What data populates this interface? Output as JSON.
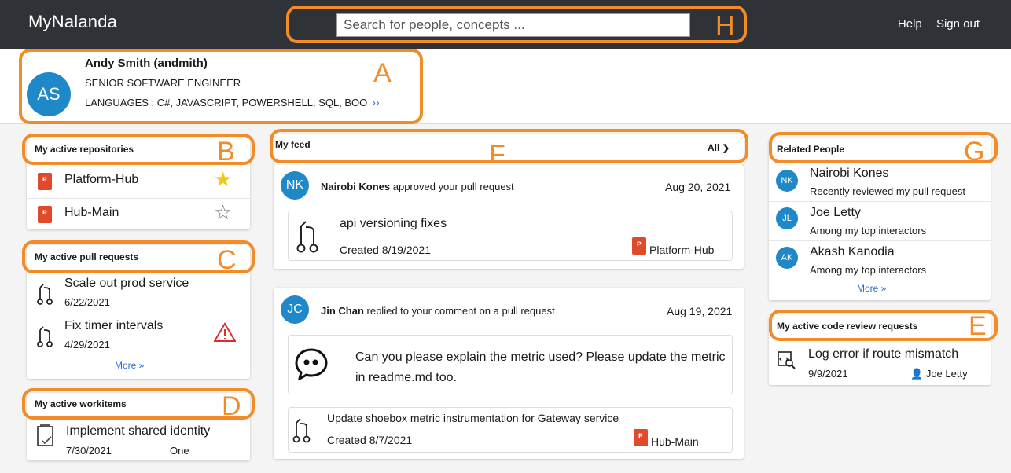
{
  "header": {
    "brand": "MyNalanda",
    "search_placeholder": "Search for people, concepts ...",
    "help": "Help",
    "signout": "Sign out"
  },
  "callouts": {
    "a": "A",
    "b": "B",
    "c": "C",
    "d": "D",
    "e": "E",
    "f": "F",
    "g": "G",
    "h": "H"
  },
  "profile": {
    "initials": "AS",
    "name": "Andy Smith (andmith)",
    "title": "SENIOR SOFTWARE ENGINEER",
    "languages": "LANGUAGES : C#, JAVASCRIPT, POWERSHELL, SQL, BOO",
    "more": "››"
  },
  "repos": {
    "heading": "My active repositories",
    "items": [
      {
        "name": "Platform-Hub"
      },
      {
        "name": "Hub-Main"
      }
    ]
  },
  "prs": {
    "heading": "My active pull requests",
    "items": [
      {
        "title": "Scale out prod service",
        "date": "6/22/2021"
      },
      {
        "title": "Fix timer intervals",
        "date": "4/29/2021"
      }
    ],
    "more": "More »"
  },
  "workitems": {
    "heading": "My active workitems",
    "items": [
      {
        "title": "Implement shared identity",
        "date": "7/30/2021",
        "tag": "One"
      }
    ]
  },
  "feed": {
    "heading": "My feed",
    "filter": "All",
    "items": [
      {
        "initials": "NK",
        "actor": "Nairobi Kones",
        "action": " approved your pull request",
        "date": "Aug 20, 2021",
        "title": "api versioning fixes",
        "created": "Created 8/19/2021",
        "repo": "Platform-Hub"
      },
      {
        "initials": "JC",
        "actor": "Jin Chan",
        "action": " replied to your comment on a pull request",
        "date": "Aug 19, 2021",
        "comment": "Can you please explain the metric used? Please update the metric in readme.md too.",
        "title": "Update shoebox metric instrumentation for Gateway service",
        "created": "Created 8/7/2021",
        "repo": "Hub-Main"
      }
    ]
  },
  "people": {
    "heading": "Related People",
    "items": [
      {
        "initials": "NK",
        "name": "Nairobi Kones",
        "reason": "Recently reviewed my pull request"
      },
      {
        "initials": "JL",
        "name": "Joe Letty",
        "reason": "Among my top interactors"
      },
      {
        "initials": "AK",
        "name": "Akash Kanodia",
        "reason": "Among my top interactors"
      }
    ],
    "more": "More »"
  },
  "reviews": {
    "heading": "My active code review requests",
    "items": [
      {
        "title": "Log error if route mismatch",
        "date": "9/9/2021",
        "person": "Joe Letty"
      }
    ]
  }
}
